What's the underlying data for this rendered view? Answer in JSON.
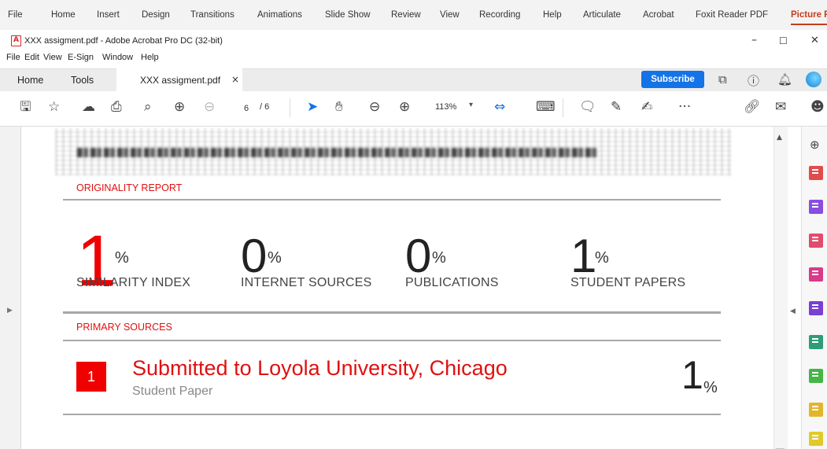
{
  "ribbon": {
    "tabs": [
      "File",
      "Home",
      "Insert",
      "Design",
      "Transitions",
      "Animations",
      "Slide Show",
      "Review",
      "View",
      "Recording",
      "Help",
      "Articulate",
      "Acrobat",
      "Foxit Reader PDF",
      "Picture F"
    ]
  },
  "window": {
    "title": "XXX assigment.pdf - Adobe Acrobat Pro DC (32-bit)",
    "controls": {
      "minimize": "–",
      "maximize": "☐",
      "close": "✕"
    }
  },
  "menubar": {
    "items": [
      "File",
      "Edit",
      "View",
      "E-Sign",
      "Window",
      "Help"
    ]
  },
  "tabbar": {
    "home": "Home",
    "tools": "Tools",
    "doc_tab": "XXX assigment.pdf",
    "doc_tab_close": "×",
    "subscribe": "Subscribe"
  },
  "toolbar": {
    "page_current": "6",
    "page_total": "/ 6",
    "zoom": "113%",
    "more": "···"
  },
  "report": {
    "originality_label": "ORIGINALITY REPORT",
    "stats": [
      {
        "value": "1",
        "unit": "%",
        "label": "SIMILARITY INDEX",
        "color": "#f00000"
      },
      {
        "value": "0",
        "unit": "%",
        "label": "INTERNET SOURCES",
        "color": "#222222"
      },
      {
        "value": "0",
        "unit": "%",
        "label": "PUBLICATIONS",
        "color": "#222222"
      },
      {
        "value": "1",
        "unit": "%",
        "label": "STUDENT PAPERS",
        "color": "#222222"
      }
    ],
    "primary_label": "PRIMARY SOURCES",
    "sources": [
      {
        "rank": "1",
        "title": "Submitted to Loyola University, Chicago",
        "type": "Student Paper",
        "value": "1",
        "unit": "%"
      }
    ]
  },
  "colors": {
    "accent": "#e01010",
    "badge": "#f00000",
    "subscribe": "#1473e6"
  }
}
